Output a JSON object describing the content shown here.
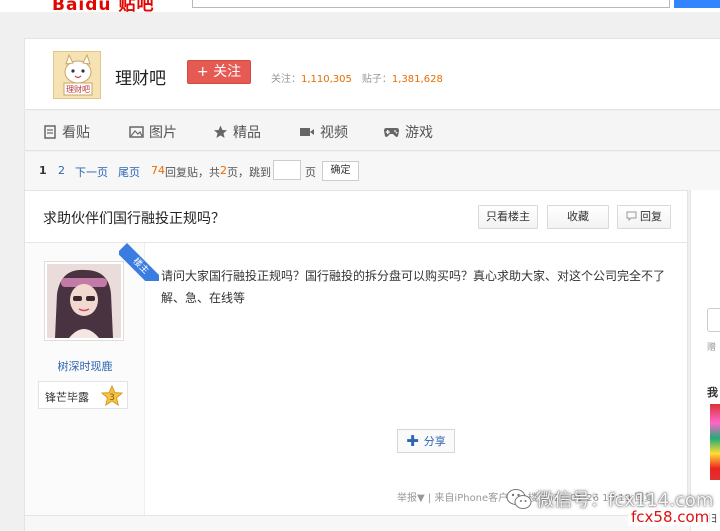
{
  "header": {
    "logo_fragment": "Baidu 贴吧"
  },
  "forum": {
    "name": "理财吧",
    "follow_label": "+ 关注",
    "follow_count_label": "关注：",
    "follow_count": "1,110,305",
    "post_count_label": "贴子：",
    "post_count": "1,381,628"
  },
  "tabs": [
    {
      "label": "看贴",
      "icon": "document-icon"
    },
    {
      "label": "图片",
      "icon": "picture-icon"
    },
    {
      "label": "精品",
      "icon": "star-icon"
    },
    {
      "label": "视频",
      "icon": "video-icon"
    },
    {
      "label": "游戏",
      "icon": "gamepad-icon"
    }
  ],
  "pager": {
    "current": "1",
    "page2": "2",
    "next": "下一页",
    "last": "尾页",
    "reply_count": "74",
    "reply_text": "回复贴，共",
    "total_pages": "2",
    "pages_text": "页，跳到",
    "page_unit": "页",
    "confirm": "确定"
  },
  "thread": {
    "title": "求助伙伴们国行融投正规吗？",
    "only_author": "只看楼主",
    "favorite": "收藏",
    "reply": "回复"
  },
  "post": {
    "floor_tag": "楼主",
    "author_name": "树深时现鹿",
    "badge_label": "锋芒毕露",
    "badge_level": "3",
    "content": "请问大家国行融投正规吗？国行融投的拆分盘可以购买吗？真心求助大家、对这个公司完全不了解、急、在线等",
    "share_label": "分享",
    "footer": "举报▼ | 来自iPhone客户端 1楼 2016-01-26 10:19 回复"
  },
  "right_rail": {
    "fragment_1": "赠",
    "fragment_2": "我",
    "fragment_3": "扫"
  },
  "watermark": {
    "wechat": "微信号：fcx114.com",
    "site": "fcx58.com"
  },
  "colors": {
    "link_blue": "#2d64b3",
    "accent_red": "#e55a52",
    "count_orange": "#e96c00"
  }
}
